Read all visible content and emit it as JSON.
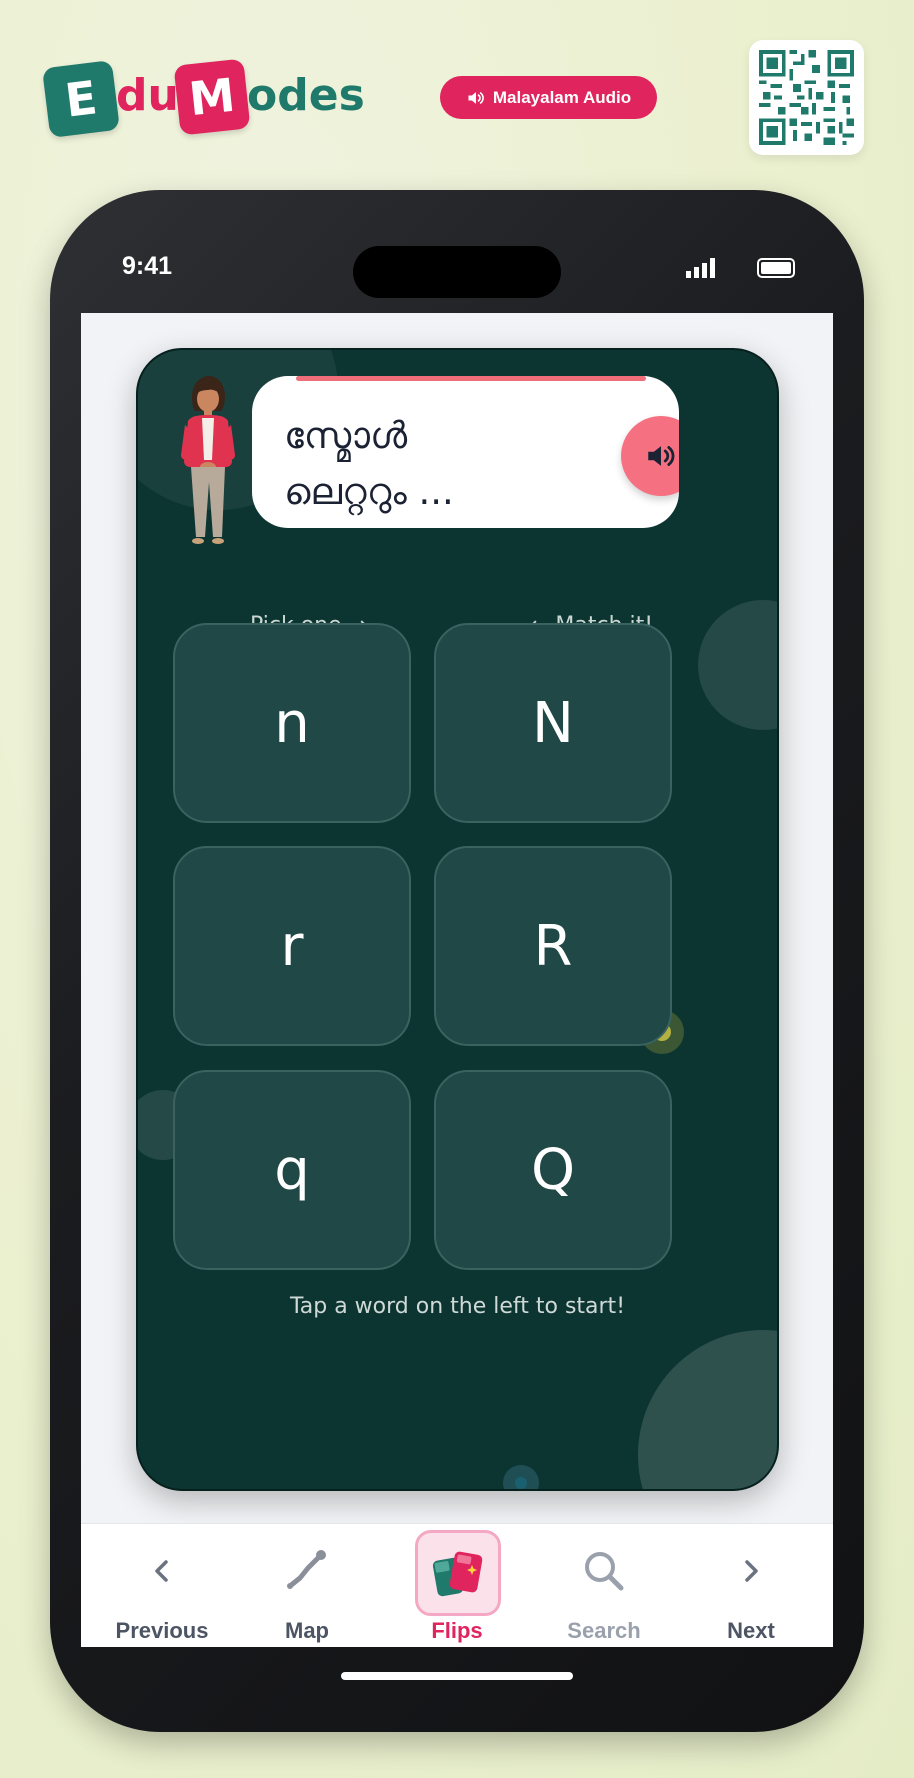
{
  "brand": {
    "tile_e": "E",
    "text_du": "du",
    "tile_m": "M",
    "text_odes": "odes",
    "colors": {
      "teal": "#1f7a6b",
      "pink": "#e0245e"
    }
  },
  "audio_button": {
    "label": "Malayalam Audio",
    "icon": "speaker-icon"
  },
  "qr": {
    "icon": "qr-code-icon"
  },
  "status_bar": {
    "time": "9:41"
  },
  "speech": {
    "line1": "സ്മോൾ",
    "line2": "ലെറ്ററും ...",
    "icon": "speaker-icon"
  },
  "hints": {
    "left": "Pick one  →",
    "right": "←  Match it!"
  },
  "tiles": [
    {
      "left": "n",
      "right": "N"
    },
    {
      "left": "r",
      "right": "R"
    },
    {
      "left": "q",
      "right": "Q"
    }
  ],
  "footer_hint": "Tap a word on the left to start!",
  "nav": {
    "previous": "Previous",
    "map": "Map",
    "flips": "Flips",
    "search": "Search",
    "next": "Next",
    "active": "Flips"
  }
}
